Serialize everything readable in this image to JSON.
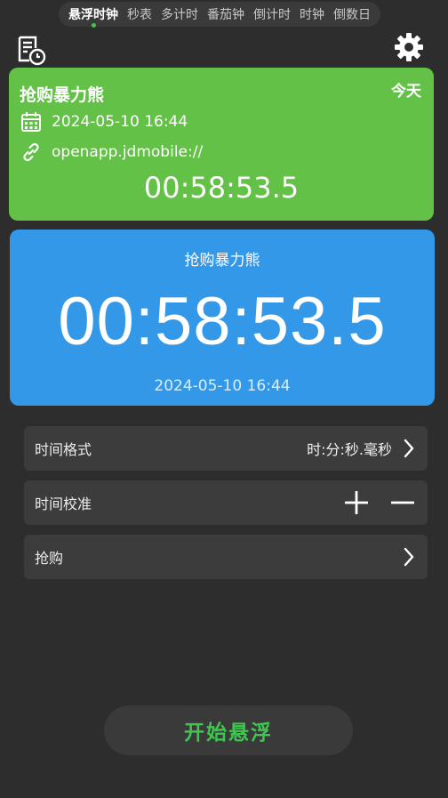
{
  "tabs": [
    {
      "label": "悬浮时钟",
      "active": true
    },
    {
      "label": "秒表",
      "active": false
    },
    {
      "label": "多计时",
      "active": false
    },
    {
      "label": "番茄钟",
      "active": false
    },
    {
      "label": "倒计时",
      "active": false
    },
    {
      "label": "时钟",
      "active": false
    },
    {
      "label": "倒数日",
      "active": false
    }
  ],
  "green_card": {
    "title": "抢购暴力熊",
    "badge": "今天",
    "datetime": "2024-05-10 16:44",
    "link": "openapp.jdmobile://",
    "time": "00:58:53.5",
    "color": "#63c147"
  },
  "blue_card": {
    "title": "抢购暴力熊",
    "time": "00:58:53.5",
    "date": "2024-05-10 16:44",
    "color": "#3398e8"
  },
  "settings": [
    {
      "label": "时间格式",
      "value": "时:分:秒.毫秒",
      "control": "chevron"
    },
    {
      "label": "时间校准",
      "value": "",
      "control": "plus-minus"
    },
    {
      "label": "抢购",
      "value": "",
      "control": "chevron"
    }
  ],
  "start_button": {
    "label": "开始悬浮",
    "color": "#3ec64f"
  },
  "icons": {
    "header_left": "record-list-icon",
    "header_right": "gear-icon",
    "calendar": "calendar-icon",
    "link": "link-icon"
  }
}
